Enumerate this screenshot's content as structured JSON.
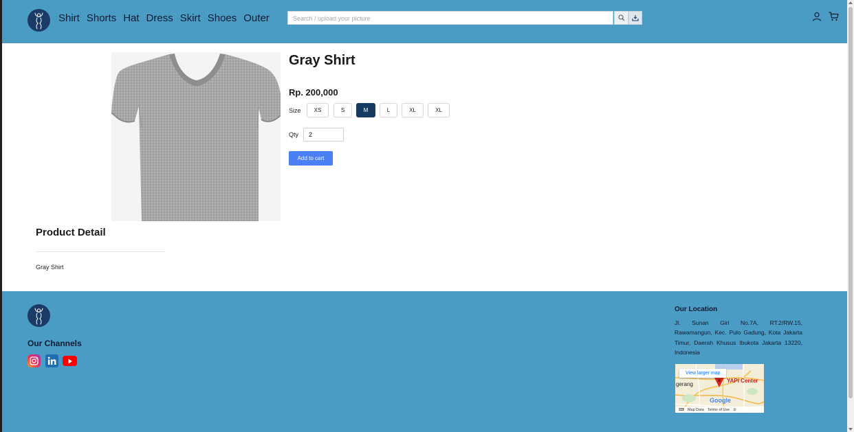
{
  "header": {
    "nav": [
      {
        "label": "Shirt"
      },
      {
        "label": "Shorts"
      },
      {
        "label": "Hat"
      },
      {
        "label": "Dress"
      },
      {
        "label": "Skirt"
      },
      {
        "label": "Shoes"
      },
      {
        "label": "Outer"
      }
    ],
    "search_placeholder": "Search / upload your picture",
    "icons": [
      "search-icon",
      "upload-icon",
      "user-icon",
      "cart-icon"
    ]
  },
  "product": {
    "title": "Gray Shirt",
    "price": "Rp. 200,000",
    "size_label": "Size",
    "sizes": [
      {
        "label": "XS",
        "selected": false
      },
      {
        "label": "S",
        "selected": false
      },
      {
        "label": "M",
        "selected": true
      },
      {
        "label": "L",
        "selected": false
      },
      {
        "label": "XL",
        "selected": false
      },
      {
        "label": "XL",
        "selected": false
      }
    ],
    "qty_label": "Qty",
    "qty_value": "2",
    "add_to_cart_label": "Add to cart"
  },
  "detail": {
    "heading": "Product Detail",
    "text": "Gray Shirt"
  },
  "footer": {
    "channels_heading": "Our Channels",
    "socials": [
      "instagram-icon",
      "linkedin-icon",
      "youtube-icon"
    ],
    "location_heading": "Our Location",
    "address": "Jl. Sunan Giri No.7A, RT.2/RW.15, Rawamangun, Kec. Pulo Gadung, Kota Jakarta Timur, Daerah Khusus Ibukota Jakarta 13220, Indonesia",
    "map": {
      "link_label": "View larger map",
      "place_label": "YAPI Center",
      "city_label": "gerang",
      "brand": "Google",
      "map_data": "Map Data",
      "terms": "Terms of Use"
    }
  },
  "colors": {
    "header_bg": "#4a9cc4",
    "footer_bg": "#4a9cc4",
    "selected_size": "#173a62",
    "button_blue": "#4a7ff5",
    "logo_bg": "#1b3a66"
  }
}
